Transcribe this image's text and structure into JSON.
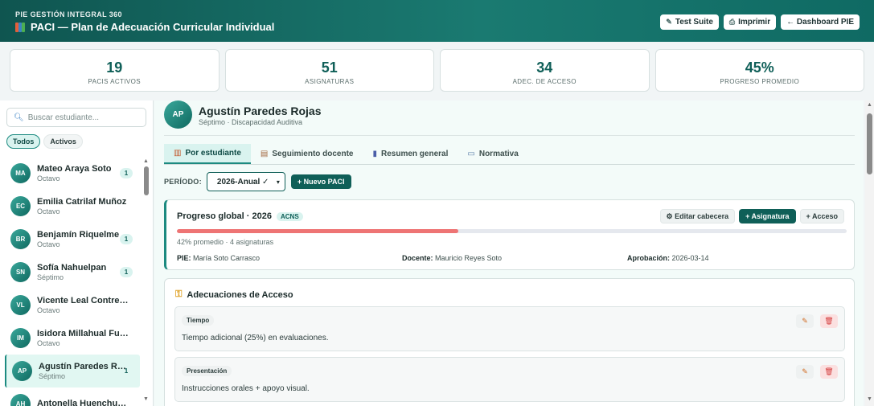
{
  "header": {
    "brand": "PIE GESTIÓN INTEGRAL 360",
    "title": "PACI — Plan de Adecuación Curricular Individual",
    "buttons": {
      "test_suite": "Test Suite",
      "print": "Imprimir",
      "dashboard": "← Dashboard PIE"
    }
  },
  "stats": [
    {
      "value": "19",
      "label": "PACIS ACTIVOS"
    },
    {
      "value": "51",
      "label": "ASIGNATURAS"
    },
    {
      "value": "34",
      "label": "ADEC. DE ACCESO"
    },
    {
      "value": "45%",
      "label": "PROGRESO PROMEDIO"
    }
  ],
  "sidebar": {
    "search_placeholder": "Buscar estudiante...",
    "filters": {
      "all": "Todos",
      "active": "Activos"
    },
    "students": [
      {
        "initials": "MA",
        "name": "Mateo Araya Soto",
        "grade": "Octavo",
        "count": "1"
      },
      {
        "initials": "EC",
        "name": "Emilia Catrilaf Muñoz",
        "grade": "Octavo",
        "count": ""
      },
      {
        "initials": "BR",
        "name": "Benjamín Riquelme",
        "grade": "Octavo",
        "count": "1"
      },
      {
        "initials": "SN",
        "name": "Sofía Nahuelpan",
        "grade": "Séptimo",
        "count": "1"
      },
      {
        "initials": "VL",
        "name": "Vicente Leal Contreras",
        "grade": "Octavo",
        "count": ""
      },
      {
        "initials": "IM",
        "name": "Isidora Millahual Fuentes",
        "grade": "Octavo",
        "count": ""
      },
      {
        "initials": "AP",
        "name": "Agustín Paredes Rojas",
        "grade": "Séptimo",
        "count": "1"
      },
      {
        "initials": "AH",
        "name": "Antonella Huenchumil",
        "grade": "",
        "count": ""
      }
    ]
  },
  "profile": {
    "initials": "AP",
    "name": "Agustín Paredes Rojas",
    "subtitle": "Séptimo · Discapacidad Auditiva"
  },
  "tabs": [
    {
      "label": "Por estudiante",
      "icon": "books-icon"
    },
    {
      "label": "Seguimiento docente",
      "icon": "clipboard-icon"
    },
    {
      "label": "Resumen general",
      "icon": "chart-icon"
    },
    {
      "label": "Normativa",
      "icon": "book-icon"
    }
  ],
  "period": {
    "label": "PERÍODO:",
    "selected": "2026-Anual ✓",
    "new_button": "+ Nuevo PACI"
  },
  "progress": {
    "title": "Progreso global · 2026",
    "badge": "ACNS",
    "actions": {
      "edit": "⚙ Editar cabecera",
      "add_subject": "+ Asignatura",
      "add_access": "+ Acceso"
    },
    "percent": 42,
    "summary": "42% promedio · 4 asignaturas",
    "pie_label": "PIE:",
    "pie_value": "María Soto Carrasco",
    "teacher_label": "Docente:",
    "teacher_value": "Mauricio Reyes Soto",
    "approval_label": "Aprobación:",
    "approval_value": "2026-03-14"
  },
  "access": {
    "title": "Adecuaciones de Acceso",
    "items": [
      {
        "tag": "Tiempo",
        "text": "Tiempo adicional (25%) en evaluaciones."
      },
      {
        "tag": "Presentación",
        "text": "Instrucciones orales + apoyo visual."
      }
    ]
  },
  "colors": {
    "brand": "#0f5f58",
    "accent": "#1c8a80",
    "progress_fill": "#ee7474"
  }
}
